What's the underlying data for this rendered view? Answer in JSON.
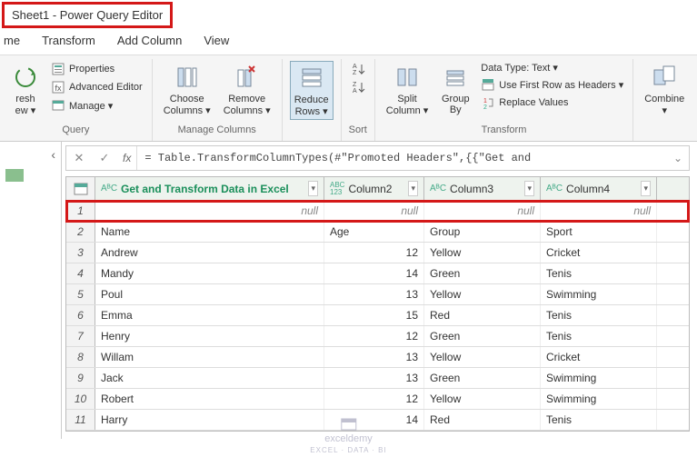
{
  "title": "Sheet1 - Power Query Editor",
  "tabs": [
    "me",
    "Transform",
    "Add Column",
    "View"
  ],
  "ribbon": {
    "query": {
      "refresh": "resh\new ▾",
      "properties": "Properties",
      "advanced": "Advanced Editor",
      "manage": "Manage ▾",
      "label": "Query"
    },
    "manage_columns": {
      "choose": "Choose\nColumns ▾",
      "remove": "Remove\nColumns ▾",
      "label": "Manage Columns"
    },
    "reduce": {
      "reduce": "Reduce\nRows ▾",
      "label": ""
    },
    "sort": {
      "label": "Sort"
    },
    "transform": {
      "split": "Split\nColumn ▾",
      "group": "Group\nBy",
      "datatype": "Data Type: Text ▾",
      "firstrow": "Use First Row as Headers ▾",
      "replace": "Replace Values",
      "label": "Transform"
    },
    "combine": {
      "combine": "Combine\n▾",
      "label": ""
    }
  },
  "formula": "= Table.TransformColumnTypes(#\"Promoted Headers\",{{\"Get and",
  "columns": [
    {
      "type": "AᴮC",
      "name": "Get and Transform Data in Excel"
    },
    {
      "type": "ABC\n123",
      "name": "Column2"
    },
    {
      "type": "AᴮC",
      "name": "Column3"
    },
    {
      "type": "AᴮC",
      "name": "Column4"
    }
  ],
  "rows": [
    {
      "n": 1,
      "c": [
        "null",
        "null",
        "null",
        "null"
      ],
      "null": true
    },
    {
      "n": 2,
      "c": [
        "Name",
        "Age",
        "Group",
        "Sport"
      ]
    },
    {
      "n": 3,
      "c": [
        "Andrew",
        "12",
        "Yellow",
        "Cricket"
      ],
      "sel": true
    },
    {
      "n": 4,
      "c": [
        "Mandy",
        "14",
        "Green",
        "Tenis"
      ]
    },
    {
      "n": 5,
      "c": [
        "Poul",
        "13",
        "Yellow",
        "Swimming"
      ]
    },
    {
      "n": 6,
      "c": [
        "Emma",
        "15",
        "Red",
        "Tenis"
      ]
    },
    {
      "n": 7,
      "c": [
        "Henry",
        "12",
        "Green",
        "Tenis"
      ]
    },
    {
      "n": 8,
      "c": [
        "Willam",
        "13",
        "Yellow",
        "Cricket"
      ]
    },
    {
      "n": 9,
      "c": [
        "Jack",
        "13",
        "Green",
        "Swimming"
      ]
    },
    {
      "n": 10,
      "c": [
        "Robert",
        "12",
        "Yellow",
        "Swimming"
      ]
    },
    {
      "n": 11,
      "c": [
        "Harry",
        "14",
        "Red",
        "Tenis"
      ]
    }
  ],
  "watermark": {
    "l1": "exceldemy",
    "l2": "EXCEL · DATA · BI"
  }
}
